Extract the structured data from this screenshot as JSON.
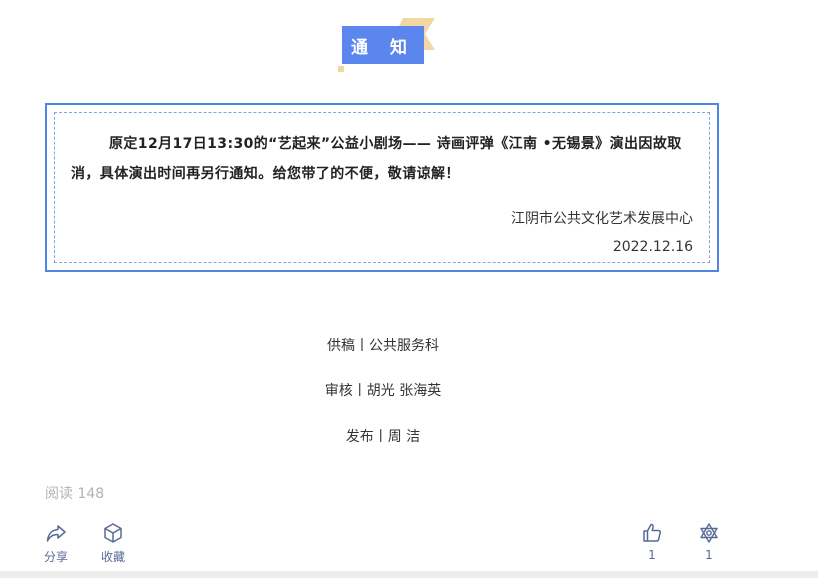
{
  "header": {
    "badge": "通 知"
  },
  "notice": {
    "body": "原定12月17日13:30的“艺起来”公益小剧场—— 诗画评弹《江南 •无锡景》演出因故取消，具体演出时间再另行通知。给您带了的不便，敬请谅解！",
    "org": "江阴市公共文化艺术发展中心",
    "date": "2022.12.16"
  },
  "credits": [
    "供稿丨公共服务科",
    "审核丨胡光 张海英",
    "发布丨周 洁"
  ],
  "stats": {
    "read": "阅读 148"
  },
  "actions": {
    "share": "分享",
    "favorite": "收藏",
    "like_count": "1",
    "wow_count": "1"
  },
  "colors": {
    "accent": "#5a86ee",
    "border": "#4e86e6",
    "deco": "#f2d7a4",
    "link": "#576b95"
  }
}
